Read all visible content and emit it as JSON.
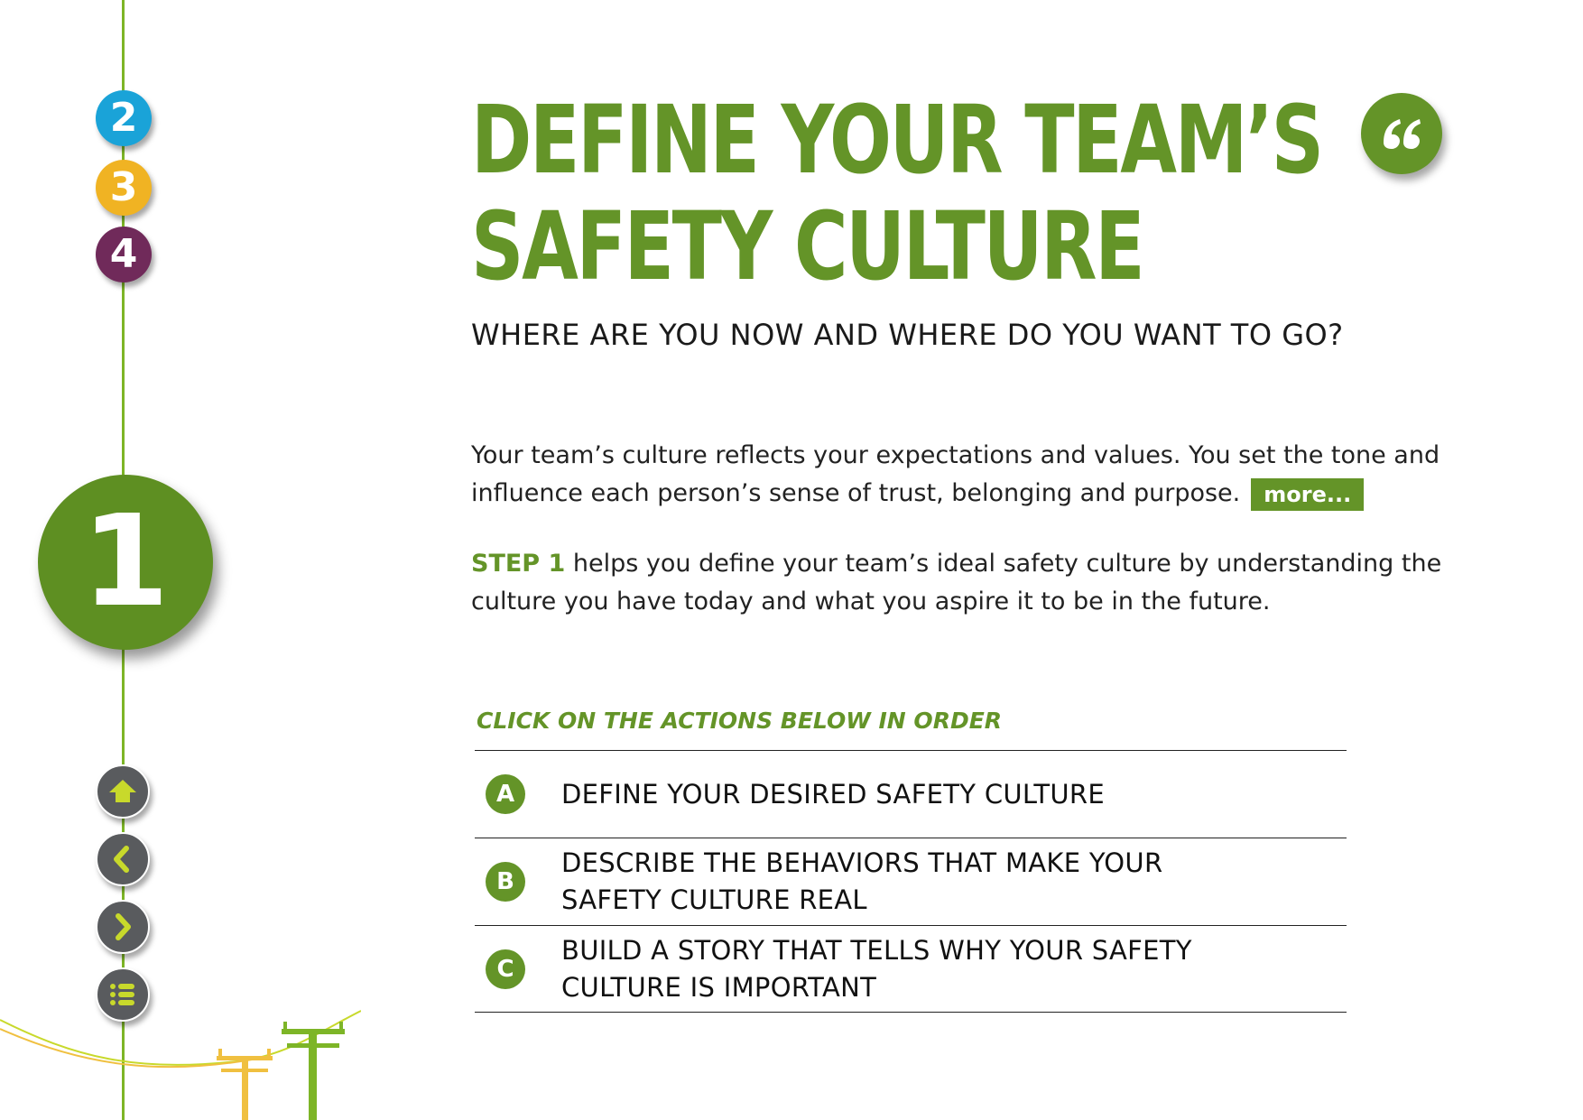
{
  "page": {
    "title_line1": "DEFINE YOUR TEAM’S",
    "title_line2": "SAFETY CULTURE",
    "subtitle": "WHERE ARE YOU NOW AND WHERE DO YOU WANT TO GO?",
    "quote_icon": "quote-icon"
  },
  "steps": {
    "current": "1",
    "items": [
      "2",
      "3",
      "4"
    ]
  },
  "intro": {
    "text": "Your team’s culture reflects your expectations and values. You set the tone and influence each person’s sense of trust, belonging and purpose.",
    "more_label": "more..."
  },
  "step_para": {
    "lead": "STEP 1",
    "text": " helps you define your team’s ideal safety culture by understanding the culture you have today and what you aspire it to be in the future."
  },
  "actions": {
    "label": "CLICK ON THE ACTIONS BELOW IN ORDER",
    "items": [
      {
        "letter": "A",
        "text": "DEFINE YOUR DESIRED SAFETY CULTURE"
      },
      {
        "letter": "B",
        "text": "DESCRIBE THE BEHAVIORS THAT MAKE YOUR\nSAFETY CULTURE REAL"
      },
      {
        "letter": "C",
        "text": "BUILD A STORY THAT TELLS WHY YOUR SAFETY\nCULTURE IS IMPORTANT"
      }
    ]
  },
  "nav": {
    "icons": [
      "home-icon",
      "back-icon",
      "next-icon",
      "menu-icon"
    ]
  },
  "colors": {
    "green": "#649428",
    "line_green": "#7db527",
    "blue": "#1aa3d8",
    "yellow": "#f0b323",
    "purple": "#702a5a",
    "nav_grey": "#595b5e",
    "nav_icon": "#c8d92b"
  }
}
